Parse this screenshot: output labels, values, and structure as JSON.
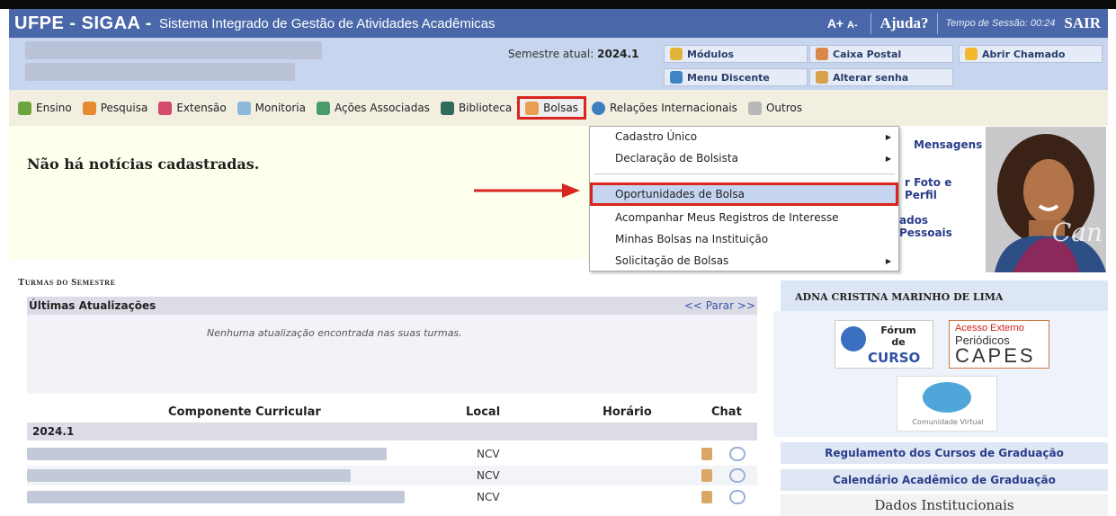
{
  "header": {
    "brand": "UFPE - SIGAA -",
    "system_name": "Sistema Integrado de Gestão de Atividades Acadêmicas",
    "font_increase": "A+",
    "font_decrease": "A-",
    "help": "Ajuda?",
    "session_time": "Tempo de Sessão: 00:24",
    "logout": "SAIR"
  },
  "info_bar": {
    "semester_label": "Semestre atual:",
    "semester_value": "2024.1",
    "buttons": {
      "modulos": "Módulos",
      "caixa_postal": "Caixa Postal",
      "abrir_chamado": "Abrir Chamado",
      "menu_discente": "Menu Discente",
      "alterar_senha": "Alterar senha"
    }
  },
  "menu": {
    "ensino": "Ensino",
    "pesquisa": "Pesquisa",
    "extensao": "Extensão",
    "monitoria": "Monitoria",
    "acoes": "Ações Associadas",
    "biblioteca": "Biblioteca",
    "bolsas": "Bolsas",
    "relacoes": "Relações Internacionais",
    "outros": "Outros"
  },
  "bolsas_menu": {
    "items": [
      "Cadastro Único",
      "Declaração de Bolsista",
      "Oportunidades de Bolsa",
      "Acompanhar Meus Registros de Interesse",
      "Minhas Bolsas na Instituição",
      "Solicitação de Bolsas"
    ]
  },
  "news": {
    "empty_message": "Não há notícias cadastradas."
  },
  "turmas": {
    "title": "Turmas do Semestre",
    "updates_header": "Últimas Atualizações",
    "pause_link": "<< Parar >>",
    "no_updates": "Nenhuma atualização encontrada nas suas turmas.",
    "columns": [
      "Componente Curricular",
      "Local",
      "Horário",
      "Chat"
    ],
    "year": "2024.1",
    "rows": [
      {
        "local": "NCV"
      },
      {
        "local": "NCV"
      },
      {
        "local": "NCV"
      }
    ]
  },
  "right_panel": {
    "links": {
      "mensagens": "Mensagens",
      "foto_perfil": "r Foto e Perfil",
      "dados_pessoais": "ados Pessoais"
    },
    "photo_watermark": "Can",
    "student_name": "ADNA CRISTINA MARINHO DE LIMA",
    "forum": {
      "line1": "Fórum",
      "line2": "de",
      "line3": "CURSO"
    },
    "capes": {
      "line1": "Acesso Externo",
      "line2": "Periódicos",
      "line3": "CAPES"
    },
    "comunidade": "Comunidade Virtual",
    "regulamento": "Regulamento dos Cursos de Graduação",
    "calendario": "Calendário Acadêmico de Graduação",
    "dados_institucionais": "Dados Institucionais"
  }
}
